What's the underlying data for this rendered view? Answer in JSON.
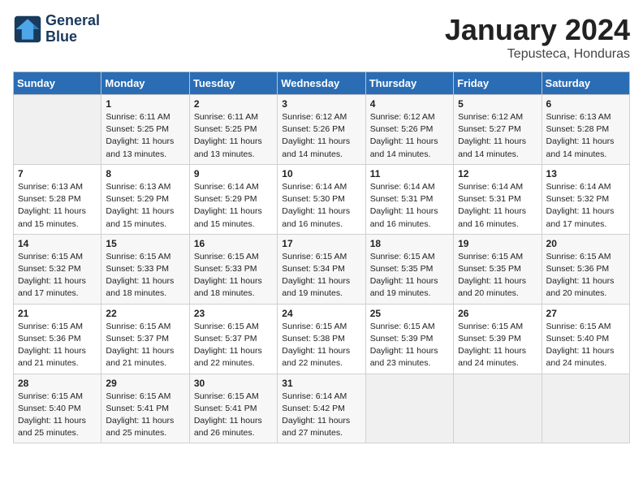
{
  "header": {
    "logo_line1": "General",
    "logo_line2": "Blue",
    "month": "January 2024",
    "location": "Tepusteca, Honduras"
  },
  "columns": [
    "Sunday",
    "Monday",
    "Tuesday",
    "Wednesday",
    "Thursday",
    "Friday",
    "Saturday"
  ],
  "weeks": [
    [
      {
        "day": "",
        "content": ""
      },
      {
        "day": "1",
        "content": "Sunrise: 6:11 AM\nSunset: 5:25 PM\nDaylight: 11 hours and 13 minutes."
      },
      {
        "day": "2",
        "content": "Sunrise: 6:11 AM\nSunset: 5:25 PM\nDaylight: 11 hours and 13 minutes."
      },
      {
        "day": "3",
        "content": "Sunrise: 6:12 AM\nSunset: 5:26 PM\nDaylight: 11 hours and 14 minutes."
      },
      {
        "day": "4",
        "content": "Sunrise: 6:12 AM\nSunset: 5:26 PM\nDaylight: 11 hours and 14 minutes."
      },
      {
        "day": "5",
        "content": "Sunrise: 6:12 AM\nSunset: 5:27 PM\nDaylight: 11 hours and 14 minutes."
      },
      {
        "day": "6",
        "content": "Sunrise: 6:13 AM\nSunset: 5:28 PM\nDaylight: 11 hours and 14 minutes."
      }
    ],
    [
      {
        "day": "7",
        "content": "Sunrise: 6:13 AM\nSunset: 5:28 PM\nDaylight: 11 hours and 15 minutes."
      },
      {
        "day": "8",
        "content": "Sunrise: 6:13 AM\nSunset: 5:29 PM\nDaylight: 11 hours and 15 minutes."
      },
      {
        "day": "9",
        "content": "Sunrise: 6:14 AM\nSunset: 5:29 PM\nDaylight: 11 hours and 15 minutes."
      },
      {
        "day": "10",
        "content": "Sunrise: 6:14 AM\nSunset: 5:30 PM\nDaylight: 11 hours and 16 minutes."
      },
      {
        "day": "11",
        "content": "Sunrise: 6:14 AM\nSunset: 5:31 PM\nDaylight: 11 hours and 16 minutes."
      },
      {
        "day": "12",
        "content": "Sunrise: 6:14 AM\nSunset: 5:31 PM\nDaylight: 11 hours and 16 minutes."
      },
      {
        "day": "13",
        "content": "Sunrise: 6:14 AM\nSunset: 5:32 PM\nDaylight: 11 hours and 17 minutes."
      }
    ],
    [
      {
        "day": "14",
        "content": "Sunrise: 6:15 AM\nSunset: 5:32 PM\nDaylight: 11 hours and 17 minutes."
      },
      {
        "day": "15",
        "content": "Sunrise: 6:15 AM\nSunset: 5:33 PM\nDaylight: 11 hours and 18 minutes."
      },
      {
        "day": "16",
        "content": "Sunrise: 6:15 AM\nSunset: 5:33 PM\nDaylight: 11 hours and 18 minutes."
      },
      {
        "day": "17",
        "content": "Sunrise: 6:15 AM\nSunset: 5:34 PM\nDaylight: 11 hours and 19 minutes."
      },
      {
        "day": "18",
        "content": "Sunrise: 6:15 AM\nSunset: 5:35 PM\nDaylight: 11 hours and 19 minutes."
      },
      {
        "day": "19",
        "content": "Sunrise: 6:15 AM\nSunset: 5:35 PM\nDaylight: 11 hours and 20 minutes."
      },
      {
        "day": "20",
        "content": "Sunrise: 6:15 AM\nSunset: 5:36 PM\nDaylight: 11 hours and 20 minutes."
      }
    ],
    [
      {
        "day": "21",
        "content": "Sunrise: 6:15 AM\nSunset: 5:36 PM\nDaylight: 11 hours and 21 minutes."
      },
      {
        "day": "22",
        "content": "Sunrise: 6:15 AM\nSunset: 5:37 PM\nDaylight: 11 hours and 21 minutes."
      },
      {
        "day": "23",
        "content": "Sunrise: 6:15 AM\nSunset: 5:37 PM\nDaylight: 11 hours and 22 minutes."
      },
      {
        "day": "24",
        "content": "Sunrise: 6:15 AM\nSunset: 5:38 PM\nDaylight: 11 hours and 22 minutes."
      },
      {
        "day": "25",
        "content": "Sunrise: 6:15 AM\nSunset: 5:39 PM\nDaylight: 11 hours and 23 minutes."
      },
      {
        "day": "26",
        "content": "Sunrise: 6:15 AM\nSunset: 5:39 PM\nDaylight: 11 hours and 24 minutes."
      },
      {
        "day": "27",
        "content": "Sunrise: 6:15 AM\nSunset: 5:40 PM\nDaylight: 11 hours and 24 minutes."
      }
    ],
    [
      {
        "day": "28",
        "content": "Sunrise: 6:15 AM\nSunset: 5:40 PM\nDaylight: 11 hours and 25 minutes."
      },
      {
        "day": "29",
        "content": "Sunrise: 6:15 AM\nSunset: 5:41 PM\nDaylight: 11 hours and 25 minutes."
      },
      {
        "day": "30",
        "content": "Sunrise: 6:15 AM\nSunset: 5:41 PM\nDaylight: 11 hours and 26 minutes."
      },
      {
        "day": "31",
        "content": "Sunrise: 6:14 AM\nSunset: 5:42 PM\nDaylight: 11 hours and 27 minutes."
      },
      {
        "day": "",
        "content": ""
      },
      {
        "day": "",
        "content": ""
      },
      {
        "day": "",
        "content": ""
      }
    ]
  ]
}
